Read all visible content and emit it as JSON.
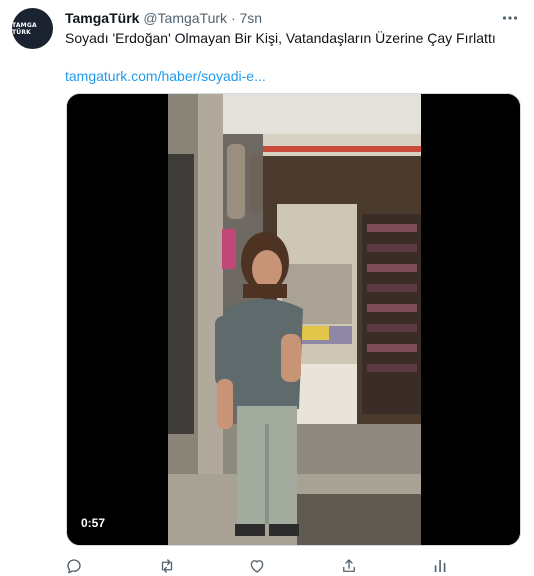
{
  "tweet": {
    "display_name": "TamgaTürk",
    "handle": "@TamgaTurk",
    "separator": "·",
    "time": "7sn",
    "text": "Soyadı 'Erdoğan' Olmayan Bir Kişi, Vatandaşların Üzerine Çay Fırlattı",
    "link": "tamgaturk.com/haber/soyadi-e...",
    "avatar_label": "TAMGA TÜRK"
  },
  "video": {
    "duration": "0:57"
  },
  "icons": {
    "more": "more-horizontal-icon",
    "reply": "reply-icon",
    "retweet": "retweet-icon",
    "like": "heart-icon",
    "share": "share-icon",
    "analytics": "analytics-icon"
  },
  "colors": {
    "link": "#1d9bf0",
    "secondary_text": "#536471",
    "primary_text": "#0f1419"
  }
}
